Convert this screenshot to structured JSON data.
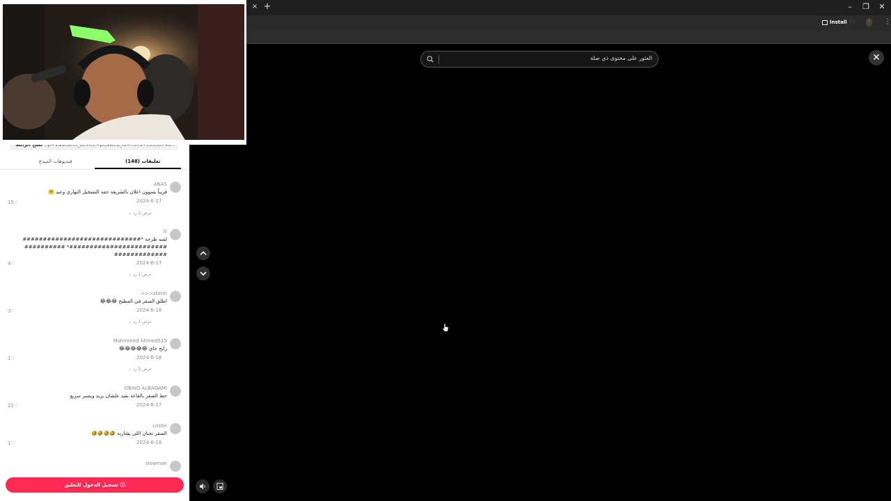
{
  "browser": {
    "tab_close": "×",
    "new_tab": "+",
    "install_label": "Install",
    "window_minimize": "–",
    "window_restore": "❐",
    "window_close": "✕"
  },
  "search": {
    "placeholder": "العثور على محتوى ذي صلة"
  },
  "player": {
    "close": "✕",
    "prev": "⌃",
    "next": "⌄",
    "volume_icon": "speaker-icon",
    "pip_icon": "picture-in-picture-icon"
  },
  "panel": {
    "link_url": "...p=1&sharer_device=pc&web_id=7372759358748...",
    "copy_link": "نسخ الرابط",
    "tabs": [
      {
        "label": "(148) تعليقات",
        "active": true
      },
      {
        "label": "فيديوهات المبدع",
        "active": false
      }
    ],
    "comments": [
      {
        "name": "ANAS",
        "text": "قريباً بسوون اعلان بالشريفة حفة التسجيل النهاري وعيد 🤗",
        "date": "2024-6-17",
        "likes": "15",
        "replies": "عرض 1 رد"
      },
      {
        "name": "lil",
        "text": "لسه طرحة *#####################################################* #######################",
        "date": "2024-6-17",
        "likes": "4",
        "replies": "عرض 1 رد"
      },
      {
        "name": "storm<<<",
        "text": "اطلق الصقر في المطبخ 😂😂😂",
        "date": "2024-6-18",
        "likes": "3",
        "replies": "عرض 1 رد"
      },
      {
        "name": "Mohmmed Ahmed515",
        "text": "رايح جاي 😂😂😂😂😂",
        "date": "2024-6-18",
        "likes": "1",
        "replies": "عرض 1 رد"
      },
      {
        "name": "OBAID ALBAQAMI",
        "text": "حط الصقر بالقاعة بقيد علشان يزيد ويصير سريع",
        "date": "2024-6-17",
        "likes": "21",
        "replies": ""
      },
      {
        "name": "Lostie",
        "text": "الصقر تجنان اللي يشاريه 🤣🤣🤣🤣",
        "date": "2024-6-18",
        "likes": "1",
        "replies": ""
      },
      {
        "name": "slowman",
        "text": "",
        "date": "",
        "likes": "",
        "replies": ""
      }
    ],
    "login_button": "تسجيل الدخول للتعليق"
  }
}
